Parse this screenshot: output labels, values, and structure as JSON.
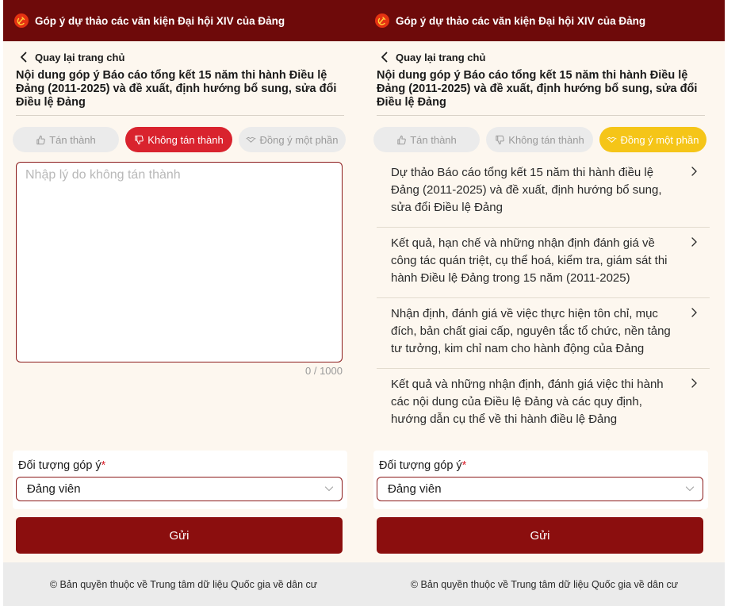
{
  "left_screen": {
    "header_title": "Góp ý dự thảo các văn kiện Đại hội XIV của Đảng",
    "back_label": "Quay lại trang chủ",
    "content_title": "Nội dung góp ý Báo cáo tổng kết 15 năm thi hành Điều lệ Đảng (2011-2025) và đề xuất, định hướng bổ sung, sửa đổi Điều lệ Đảng",
    "choices": {
      "agree": "Tán thành",
      "disagree": "Không tán thành",
      "partial": "Đồng ý một phần",
      "selected": "disagree"
    },
    "reason_placeholder": "Nhập lý do không tán thành",
    "reason_value": "",
    "char_counter": "0 / 1000",
    "target_label": "Đối tượng góp ý",
    "required_mark": "*",
    "target_value": "Đảng viên",
    "submit_label": "Gửi",
    "footer_text": "© Bản quyền thuộc về Trung tâm dữ liệu Quốc gia về dân cư"
  },
  "right_screen": {
    "header_title": "Góp ý dự thảo các văn kiện Đại hội XIV của Đảng",
    "back_label": "Quay lại trang chủ",
    "content_title": "Nội dung góp ý Báo cáo tổng kết 15 năm thi hành Điều lệ Đảng (2011-2025) và đề xuất, định hướng bổ sung, sửa đổi Điều lệ Đảng",
    "choices": {
      "agree": "Tán thành",
      "disagree": "Không tán thành",
      "partial": "Đồng ý một phần",
      "selected": "partial"
    },
    "sections": [
      "Dự thảo Báo cáo tổng kết 15 năm thi hành điều lệ Đảng (2011-2025) và đề xuất, định hướng bổ sung, sửa đổi Điều lệ Đảng",
      "Kết quả, hạn chế và những nhận định đánh giá về công tác quán triệt, cụ thể hoá, kiểm tra, giám sát thi hành Điều lệ Đảng trong 15 năm (2011-2025)",
      "Nhận định, đánh giá về việc thực hiện tôn chỉ, mục đích, bản chất giai cấp, nguyên tắc tổ chức, nền tảng tư tưởng, kim chỉ nam cho hành động của Đảng",
      "Kết quả và những nhận định, đánh giá việc thi hành các nội dung của Điều lệ Đảng và các quy định, hướng dẫn cụ thể về thi hành điều lệ Đảng"
    ],
    "target_label": "Đối tượng góp ý",
    "required_mark": "*",
    "target_value": "Đảng viên",
    "submit_label": "Gửi",
    "footer_text": "© Bản quyền thuộc về Trung tâm dữ liệu Quốc gia về dân cư"
  },
  "colors": {
    "header_bg": "#6e0a0a",
    "primary_button": "#8b0e0e",
    "disagree_active": "#d9232e",
    "partial_active": "#f5c518",
    "inactive_chip": "#ebebeb",
    "page_bg": "#fdf7ef"
  },
  "icons": {
    "logo": "hammer-sickle-icon",
    "back": "chevron-left-icon",
    "agree": "thumbs-up-icon",
    "disagree": "thumbs-down-icon",
    "partial": "handshake-icon",
    "section": "chevron-right-icon",
    "select": "chevron-down-icon"
  }
}
